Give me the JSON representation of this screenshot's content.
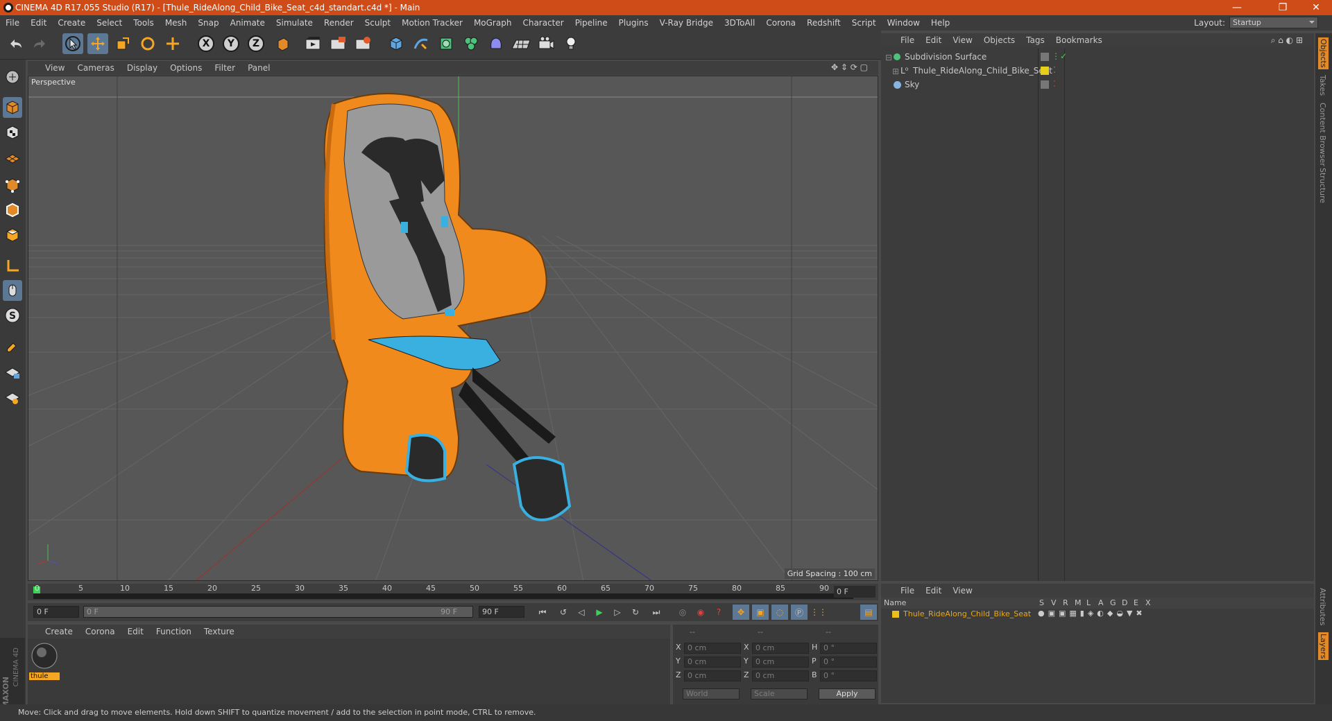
{
  "window": {
    "title": "CINEMA 4D R17.055 Studio (R17) - [Thule_RideAlong_Child_Bike_Seat_c4d_standart.c4d *] - Main",
    "minimize": "—",
    "maximize": "❐",
    "close": "✕"
  },
  "menu": [
    "File",
    "Edit",
    "Create",
    "Select",
    "Tools",
    "Mesh",
    "Snap",
    "Animate",
    "Simulate",
    "Render",
    "Sculpt",
    "Motion Tracker",
    "MoGraph",
    "Character",
    "Pipeline",
    "Plugins",
    "V-Ray Bridge",
    "3DToAll",
    "Corona",
    "Redshift",
    "Script",
    "Window",
    "Help"
  ],
  "layout": {
    "label": "Layout:",
    "value": "Startup"
  },
  "toolbar": {
    "x": "X",
    "y": "Y",
    "z": "Z"
  },
  "viewport": {
    "menu": [
      "View",
      "Cameras",
      "Display",
      "Options",
      "Filter",
      "Panel"
    ],
    "name": "Perspective",
    "grid_spacing": "Grid Spacing : 100 cm"
  },
  "timeline": {
    "ticks": [
      "0",
      "5",
      "10",
      "15",
      "20",
      "25",
      "30",
      "35",
      "40",
      "45",
      "50",
      "55",
      "60",
      "65",
      "70",
      "75",
      "80",
      "85",
      "90"
    ],
    "end_frame": "0 F"
  },
  "transport": {
    "start": "0 F",
    "range_start": "0 F",
    "range_end": "90 F",
    "end": "90 F"
  },
  "materials": {
    "menu": [
      "Create",
      "Corona",
      "Edit",
      "Function",
      "Texture"
    ],
    "items": [
      {
        "name": "thule"
      }
    ]
  },
  "coords": {
    "headers": [
      "--",
      "--",
      "--"
    ],
    "rows": [
      {
        "a": "X",
        "av": "0 cm",
        "b": "X",
        "bv": "0 cm",
        "c": "H",
        "cv": "0 °"
      },
      {
        "a": "Y",
        "av": "0 cm",
        "b": "Y",
        "bv": "0 cm",
        "c": "P",
        "cv": "0 °"
      },
      {
        "a": "Z",
        "av": "0 cm",
        "b": "Z",
        "bv": "0 cm",
        "c": "B",
        "cv": "0 °"
      }
    ],
    "mode": "World",
    "scale": "Scale",
    "apply": "Apply"
  },
  "objects": {
    "menu": [
      "File",
      "Edit",
      "View",
      "Objects",
      "Tags",
      "Bookmarks"
    ],
    "items": [
      {
        "name": "Subdivision Surface",
        "indent": 0
      },
      {
        "name": "Thule_RideAlong_Child_Bike_Seat",
        "indent": 1
      },
      {
        "name": "Sky",
        "indent": 0
      }
    ]
  },
  "layers": {
    "menu": [
      "File",
      "Edit",
      "View"
    ],
    "headers": [
      "Name",
      "S",
      "V",
      "R",
      "M",
      "L",
      "A",
      "G",
      "D",
      "E",
      "X"
    ],
    "items": [
      {
        "name": "Thule_RideAlong_Child_Bike_Seat",
        "color": "#e8c21a"
      }
    ]
  },
  "right_tabs": [
    "Objects",
    "Takes",
    "Content Browser",
    "Structure",
    "Attributes",
    "Layers"
  ],
  "status": "Move: Click and drag to move elements. Hold down SHIFT to quantize movement / add to the selection in point mode, CTRL to remove.",
  "branding": {
    "maxon": "MAXON",
    "cinema": "CINEMA 4D"
  },
  "colors": {
    "title_bar": "#cf4b17",
    "selection": "#5d7894",
    "seat": "#f08a1c",
    "layer_text": "#e8a81a"
  }
}
